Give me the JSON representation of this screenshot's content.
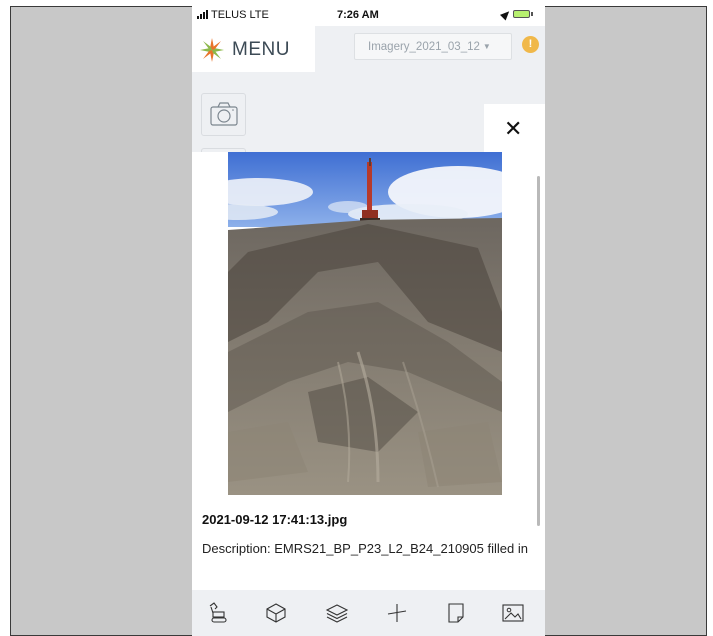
{
  "status_bar": {
    "carrier": "TELUS  LTE",
    "time": "7:26 AM"
  },
  "header": {
    "menu_label": "MENU",
    "imagery_select": "Imagery_2021_03_12",
    "alert_badge": "!"
  },
  "photo_viewer": {
    "close_label": "✕",
    "filename": "2021-09-12 17:41:13.jpg",
    "description": "Description: EMRS21_BP_P23_L2_B24_210905 filled in"
  },
  "toolbar": {
    "tools": [
      "excavator-icon",
      "cube-icon",
      "layers-icon",
      "measure-icon",
      "document-icon",
      "image-icon"
    ]
  },
  "colors": {
    "accent": "#f0b84a",
    "logo_orange": "#e8742a",
    "logo_green": "#8cb84a",
    "header_text": "#3c4a55"
  }
}
